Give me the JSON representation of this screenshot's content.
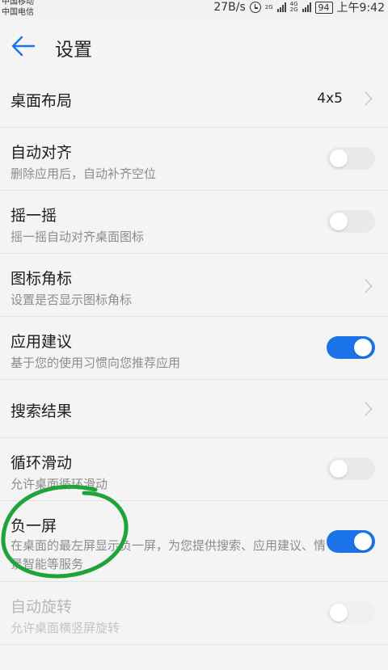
{
  "status_bar": {
    "carrier_1": "中国移动",
    "carrier_2": "中国电信",
    "network_speed": "27B/s",
    "network_tag_1": "2G",
    "network_tag_2a": "4G",
    "network_tag_2b": "2G",
    "battery": "94",
    "time": "上午9:42"
  },
  "header": {
    "title": "设置"
  },
  "settings": {
    "desktop_layout": {
      "title": "桌面布局",
      "value": "4x5"
    },
    "auto_align": {
      "title": "自动对齐",
      "subtitle": "删除应用后，自动补齐空位",
      "enabled": false
    },
    "shake": {
      "title": "摇一摇",
      "subtitle": "摇一摇自动对齐桌面图标",
      "enabled": false
    },
    "icon_badge": {
      "title": "图标角标",
      "subtitle": "设置是否显示图标角标"
    },
    "app_suggest": {
      "title": "应用建议",
      "subtitle": "基于您的使用习惯向您推荐应用",
      "enabled": true
    },
    "search_results": {
      "title": "搜索结果"
    },
    "loop_scroll": {
      "title": "循环滑动",
      "subtitle": "允许桌面循环滑动",
      "enabled": false
    },
    "minus_one_screen": {
      "title": "负一屏",
      "subtitle": "在桌面的最左屏显示负一屏，为您提供搜索、应用建议、情景智能等服务",
      "enabled": true
    },
    "auto_rotate": {
      "title": "自动旋转",
      "subtitle": "允许桌面横竖屏旋转",
      "enabled": false,
      "disabled": true
    }
  },
  "colors": {
    "accent": "#1b73e8",
    "annotation": "#1fa33a"
  }
}
